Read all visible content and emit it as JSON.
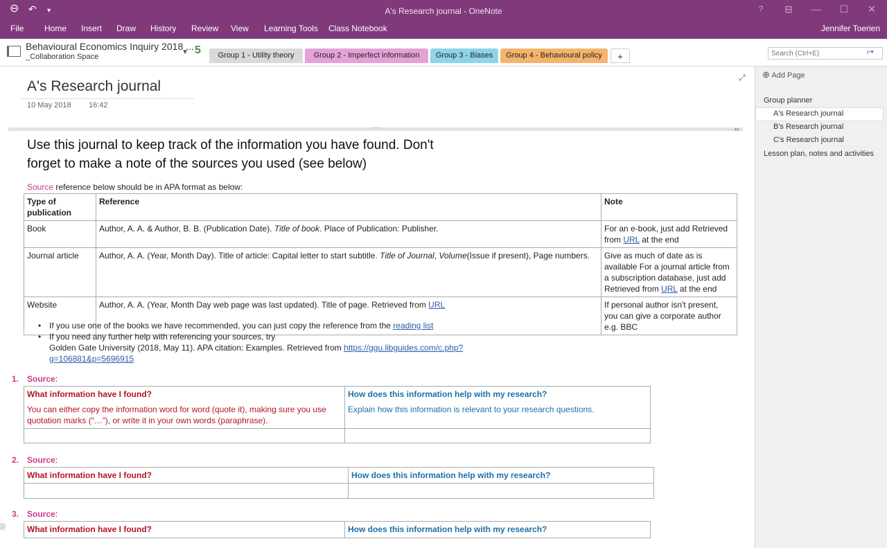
{
  "titlebar": {
    "title": "A's Research journal - OneNote",
    "back_icon": "back-circle-icon",
    "undo_icon": "undo-icon",
    "help": "?"
  },
  "menu": {
    "items": [
      "File",
      "Home",
      "Insert",
      "Draw",
      "History",
      "Review",
      "View",
      "Learning Tools",
      "Class Notebook"
    ],
    "user": "Jennifer Toerien"
  },
  "notebook": {
    "name": "Behavioural Economics Inquiry 2018 ...",
    "section_group": "_Collaboration Space",
    "sync_badge": "5",
    "tabs": [
      {
        "label": "Group 1 - Utility theory",
        "color": "#d9d9d9"
      },
      {
        "label": "Group 2 - Imperfect information",
        "color": "#e5a1d8"
      },
      {
        "label": "Group 3 - Biases",
        "color": "#8fd3e8"
      },
      {
        "label": "Group 4 - Behavioural policy",
        "color": "#f5b36c"
      }
    ],
    "add_tab": "+",
    "search_placeholder": "Search (Ctrl+E)"
  },
  "pages_panel": {
    "add_page": "Add Page",
    "pages": [
      {
        "label": "Group planner",
        "level": 0
      },
      {
        "label": "A's Research journal",
        "level": 1,
        "selected": true
      },
      {
        "label": "B's Research journal",
        "level": 1
      },
      {
        "label": "C's Research journal",
        "level": 1
      },
      {
        "label": "Lesson plan, notes and activities",
        "level": 0
      }
    ]
  },
  "page": {
    "title": "A's Research journal",
    "date": "10 May 2018",
    "time": "16:42",
    "intro_line1": "Use this journal to keep track of the information you have found. Don't",
    "intro_line2": "forget to make a note of the sources you used (see below)",
    "source_word": "Source",
    "source_rest": " reference below should be in APA format as below:",
    "ref_table": {
      "headers": [
        "Type of publication",
        "Reference",
        "Note"
      ],
      "rows": [
        {
          "type": "Book",
          "ref_a": "Author, A. A. & Author, B. B. (Publication Date). ",
          "ref_italic": "Title of book",
          "ref_b": ". Place of Publication: Publisher.",
          "note_a": " For an e-book, just add Retrieved from ",
          "note_link": "URL",
          "note_b": " at the end"
        },
        {
          "type": "Journal article",
          "ref_a": "Author, A. A. (Year, Month Day). Title of article: Capital letter to start subtitle. ",
          "ref_italic": "Title of Journal",
          "ref_mid": ", ",
          "ref_italic2": "Volume",
          "ref_b": "(Issue if present), Page numbers.",
          "note_a": "Give as much of date as is available For a journal article from a subscription database, just add Retrieved from ",
          "note_link": "URL",
          "note_b": " at the end"
        },
        {
          "type": "Website",
          "ref_a": "Author, A. A. (Year, Month Day web page was last updated). Title of page. Retrieved from ",
          "ref_link": "URL",
          "note_a": "If personal author isn't present, you can give a corporate author e.g. BBC"
        }
      ]
    },
    "bullets": {
      "b1_text": "If you use one of the books we have recommended, you can just copy the reference from the ",
      "b1_link": "reading list",
      "b2_line1": "If you need any further help with referencing your sources, try",
      "b2_line2": "Golden Gate University (2018, May 11). APA citation: Examples. Retrieved from ",
      "b2_link1": "https://ggu.libguides.com/c.php?",
      "b2_link2": "g=106881&p=5696915"
    },
    "sources": [
      {
        "number": "1.",
        "label": "Source",
        "colon": ":",
        "left_head": "What information have I found?",
        "right_head": "How does this information help with my research?",
        "left_hint": "You can either copy the information word for word (quote it), making sure you use quotation marks (“…”), or write it in your own words (paraphrase).",
        "right_hint": "Explain how this information is relevant to your research questions."
      },
      {
        "number": "2.",
        "label": "Source",
        "colon": ":",
        "left_head": "What information have I found?",
        "right_head": "How does this information help with my research?"
      },
      {
        "number": "3.",
        "label": "Source",
        "colon": ":",
        "left_head": "What information have I found?",
        "right_head": "How does this information help with my research?"
      }
    ]
  }
}
